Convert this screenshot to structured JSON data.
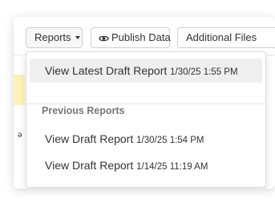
{
  "toolbar": {
    "reports_label": "Reports",
    "publish_label": "Publish Data",
    "additional_label": "Additional Files"
  },
  "dropdown": {
    "latest": {
      "label": "View Latest Draft Report",
      "date": "1/30/25 1:55 PM"
    },
    "section_header": "Previous Reports",
    "previous": [
      {
        "label": "View Draft Report",
        "date": "1/30/25 1:54 PM"
      },
      {
        "label": "View Draft Report",
        "date": "1/14/25 11:19 AM"
      }
    ]
  },
  "colors": {
    "highlight": "#efefef",
    "header_text": "#777777",
    "warning_strip": "#fff2b8"
  },
  "icons": {
    "publish": "eye-icon",
    "reports": "caret-down-icon"
  }
}
